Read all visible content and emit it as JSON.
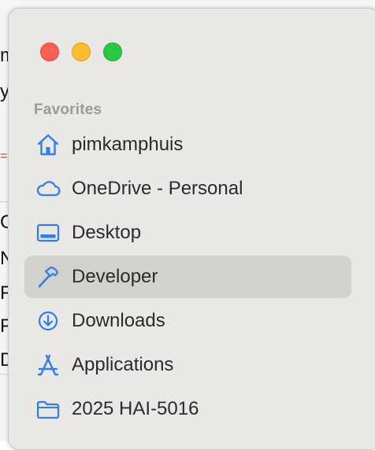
{
  "window": {
    "traffic_lights": [
      "close",
      "minimize",
      "zoom"
    ]
  },
  "sidebar": {
    "section_title": "Favorites",
    "accent_color": "#2f7cf6",
    "selected_index": 3,
    "items": [
      {
        "label": "pimkamphuis",
        "icon": "home-icon"
      },
      {
        "label": "OneDrive - Personal",
        "icon": "cloud-icon"
      },
      {
        "label": "Desktop",
        "icon": "desktop-icon"
      },
      {
        "label": "Developer",
        "icon": "hammer-icon"
      },
      {
        "label": "Downloads",
        "icon": "download-icon"
      },
      {
        "label": "Applications",
        "icon": "applications-icon"
      },
      {
        "label": "2025 HAI-5016",
        "icon": "folder-icon"
      }
    ]
  },
  "background": {
    "glyphs": [
      "m",
      "y",
      "=",
      "C",
      "N",
      "F",
      "F",
      "D"
    ]
  }
}
